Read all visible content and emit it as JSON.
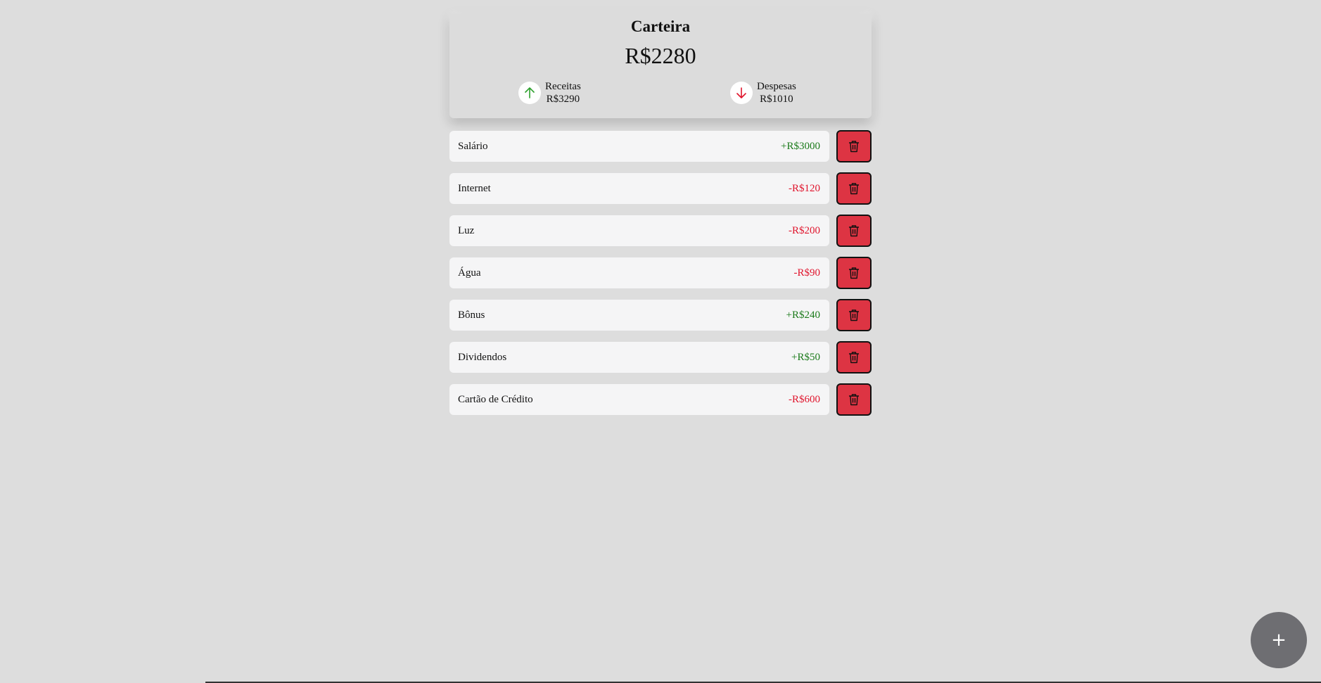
{
  "wallet": {
    "title": "Carteira",
    "balance": "R$2280",
    "income": {
      "label": "Receitas",
      "value": "R$3290",
      "icon": "arrow-up-icon",
      "color": "#2ca02c"
    },
    "expense": {
      "label": "Despesas",
      "value": "R$1010",
      "icon": "arrow-down-icon",
      "color": "#e0142c"
    }
  },
  "transactions": [
    {
      "name": "Salário",
      "amount": "+R$3000",
      "type": "positive"
    },
    {
      "name": "Internet",
      "amount": "-R$120",
      "type": "negative"
    },
    {
      "name": "Luz",
      "amount": "-R$200",
      "type": "negative"
    },
    {
      "name": "Água",
      "amount": "-R$90",
      "type": "negative"
    },
    {
      "name": "Bônus",
      "amount": "+R$240",
      "type": "positive"
    },
    {
      "name": "Dividendos",
      "amount": "+R$50",
      "type": "positive"
    },
    {
      "name": "Cartão de Crédito",
      "amount": "-R$600",
      "type": "negative"
    }
  ],
  "delete_icon": "trash-icon",
  "fab": {
    "label": "+",
    "icon": "plus-icon"
  },
  "colors": {
    "positive": "#1a7a1a",
    "negative": "#e0142c",
    "delete_button": "#dd3443",
    "fab": "#6e6e72"
  }
}
